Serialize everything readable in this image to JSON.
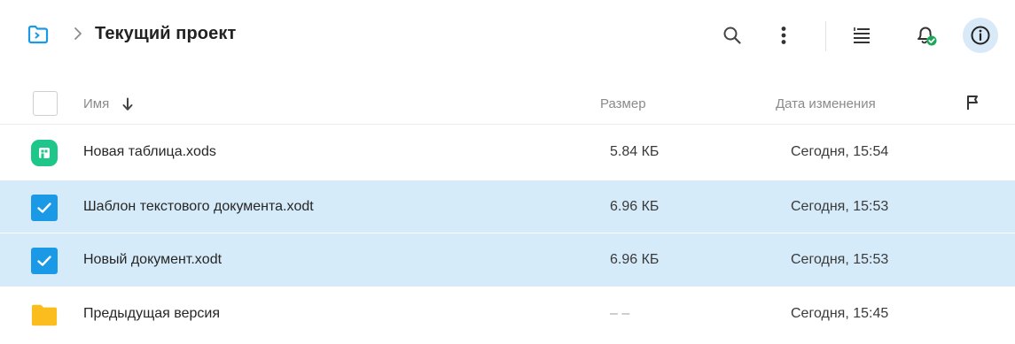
{
  "breadcrumb": {
    "title": "Текущий проект"
  },
  "toolbar": {
    "search_icon": "search-icon",
    "more_icon": "more-vertical-icon",
    "sort_icon": "sort-list-icon",
    "notifications_icon": "bell-check-icon",
    "info_icon": "info-icon"
  },
  "columns": {
    "name": "Имя",
    "size": "Размер",
    "modified": "Дата изменения"
  },
  "files": [
    {
      "name": "Новая таблица.xods",
      "size": "5.84 КБ",
      "modified": "Сегодня, 15:54",
      "type": "spreadsheet",
      "selected": false
    },
    {
      "name": "Шаблон текстового документа.xodt",
      "size": "6.96 КБ",
      "modified": "Сегодня, 15:53",
      "type": "document",
      "selected": true
    },
    {
      "name": "Новый документ.xodt",
      "size": "6.96 КБ",
      "modified": "Сегодня, 15:53",
      "type": "document",
      "selected": true
    },
    {
      "name": "Предыдущая версия",
      "size": "– –",
      "modified": "Сегодня, 15:45",
      "type": "folder",
      "selected": false
    }
  ],
  "colors": {
    "accent": "#1a9ae6",
    "selected_row": "#d6ebf9",
    "spreadsheet": "#1ec68a",
    "folder": "#fbbd1e",
    "status_ok": "#1ba65a"
  }
}
